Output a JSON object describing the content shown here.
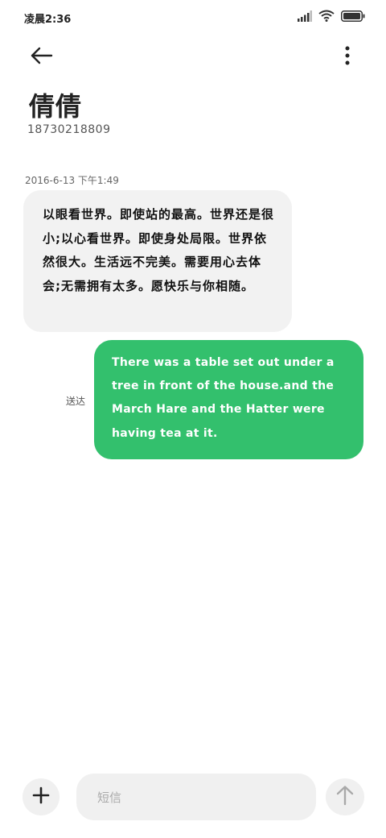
{
  "status_bar": {
    "time": "凌晨2:36",
    "icons": [
      "signal-icon",
      "wifi-icon",
      "battery-icon"
    ]
  },
  "top_bar": {
    "back_icon": "arrow-left-icon",
    "more_icon": "more-vertical-icon"
  },
  "contact": {
    "name": "倩倩",
    "number": "18730218809"
  },
  "thread": {
    "timestamp": "2016-6-13  下午1:49",
    "messages": [
      {
        "direction": "incoming",
        "text": "以眼看世界。即使站的最高。世界还是很小;以心看世界。即使身处局限。世界依然很大。生活远不完美。需要用心去体会;无需拥有太多。愿快乐与你相随。"
      },
      {
        "direction": "outgoing",
        "status": "送达",
        "text": "There was a table set out under a tree in front of the house.and the March Hare and the Hatter were having tea at it."
      }
    ]
  },
  "composer": {
    "placeholder": "短信",
    "value": "",
    "add_icon": "plus-icon",
    "send_icon": "arrow-up-icon"
  },
  "colors": {
    "outgoing_bubble": "#33c06d",
    "incoming_bubble": "#f2f2f2",
    "background": "#ffffff"
  }
}
